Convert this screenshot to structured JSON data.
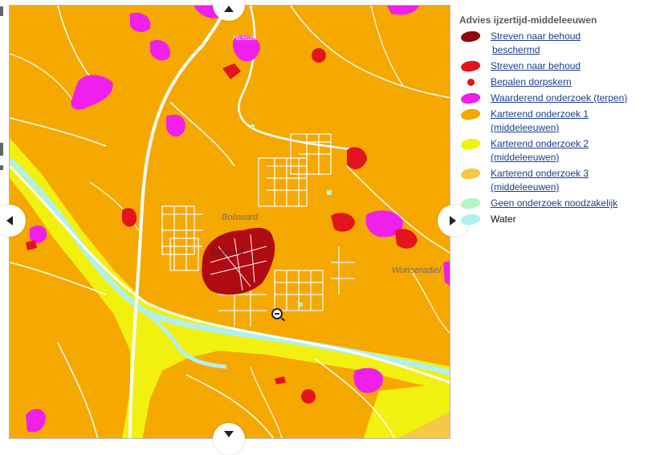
{
  "legend": {
    "title": "Advies ijzertijd-middeleeuwen",
    "items": [
      {
        "label": "Streven naar behoud",
        "label2": "beschermd",
        "color": "#8b0a0f",
        "shape": "blob",
        "link": true
      },
      {
        "label": "Streven naar behoud",
        "color": "#e3141b",
        "shape": "blob",
        "link": true
      },
      {
        "label": "Bepalen dorpskern",
        "color": "#e3141b",
        "shape": "dot",
        "link": true
      },
      {
        "label": "Waarderend onderzoek (terpen)",
        "color": "#ef1fec",
        "shape": "blob",
        "link": true
      },
      {
        "label": "Karterend onderzoek 1",
        "label2": "(middeleeuwen)",
        "color": "#f5a800",
        "shape": "blob",
        "link": true
      },
      {
        "label": "Karterend onderzoek 2",
        "label2": "(middeleeuwen)",
        "color": "#f2f00e",
        "shape": "blob",
        "link": true
      },
      {
        "label": "Karterend onderzoek 3",
        "label2": "(middeleeuwen)",
        "color": "#f5c847",
        "shape": "blob",
        "link": true
      },
      {
        "label": "Geen onderzoek noodzakelijk",
        "color": "#b5f5c3",
        "shape": "blob",
        "link": true
      },
      {
        "label": "Water",
        "color": "#aef1f1",
        "shape": "blob",
        "link": false
      }
    ]
  },
  "map": {
    "labels": {
      "town1": "Bolsward",
      "town2": "Bolsward",
      "place_east": "Wunseradiel",
      "place_north": "Hichtum"
    },
    "colors": {
      "base": "#f5a800",
      "yellow": "#f2f00e",
      "magenta": "#ef1fec",
      "red": "#e3141b",
      "darkred": "#b00a12",
      "water": "#aef1f1",
      "road": "#ffffff"
    }
  },
  "controls": {
    "pan_up_icon": "triangle-up-icon",
    "pan_down_icon": "triangle-down-icon",
    "pan_left_icon": "triangle-left-icon",
    "pan_right_icon": "triangle-right-icon",
    "zoom_out_icon": "zoom-out-icon"
  }
}
